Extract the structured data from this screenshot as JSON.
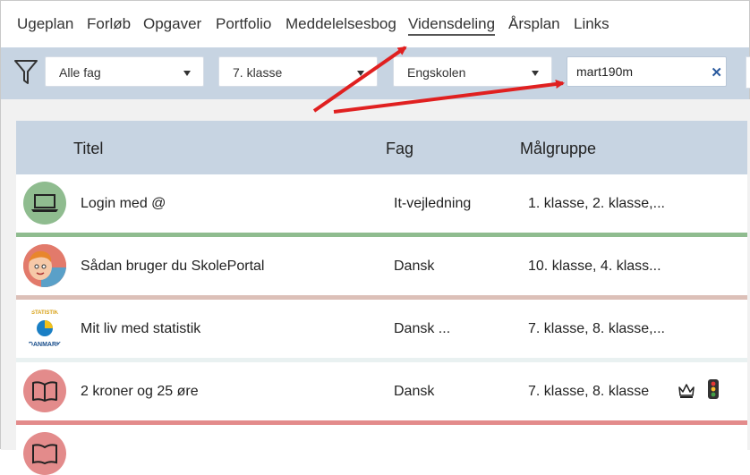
{
  "nav": {
    "items": [
      "Ugeplan",
      "Forløb",
      "Opgaver",
      "Portfolio",
      "Meddelelsesbog",
      "Vidensdeling",
      "Årsplan",
      "Links"
    ],
    "active": "Vidensdeling"
  },
  "filters": {
    "subject": "Alle fag",
    "grade": "7. klasse",
    "school": "Engskolen",
    "search_value": "mart190m"
  },
  "table": {
    "headers": {
      "title": "Titel",
      "subject": "Fag",
      "audience": "Målgruppe"
    },
    "rows": [
      {
        "title": "Login med @",
        "subject": "It-vejledning",
        "audience": "1. klasse, 2. klasse,...",
        "icon": "laptop-icon",
        "stripe_color": "#8fbc8f"
      },
      {
        "title": "Sådan bruger du SkolePortal",
        "subject": "Dansk",
        "audience": "10. klasse, 4. klass...",
        "icon": "cartoon-avatar-icon",
        "stripe_color": "#dcc0b8"
      },
      {
        "title": "Mit liv med statistik",
        "subject": "Dansk ...",
        "audience": "7. klasse, 8. klasse,...",
        "icon": "statistics-logo-icon",
        "stripe_color": "#e9f1f1"
      },
      {
        "title": "2 kroner og 25 øre",
        "subject": "Dansk",
        "audience": "7. klasse, 8. klasse",
        "icon": "book-icon",
        "stripe_color": "#e38b8b",
        "badges": [
          "crown-icon",
          "traffic-light-icon"
        ]
      }
    ]
  },
  "statistics_logo_text": {
    "top": "STATISTIK",
    "bottom": "DANMARK"
  },
  "colors": {
    "filter_bar": "#c7d4e2",
    "arrow": "#e02020",
    "green_avatar": "#8fbc8f",
    "red_avatar": "#e38b8b"
  }
}
